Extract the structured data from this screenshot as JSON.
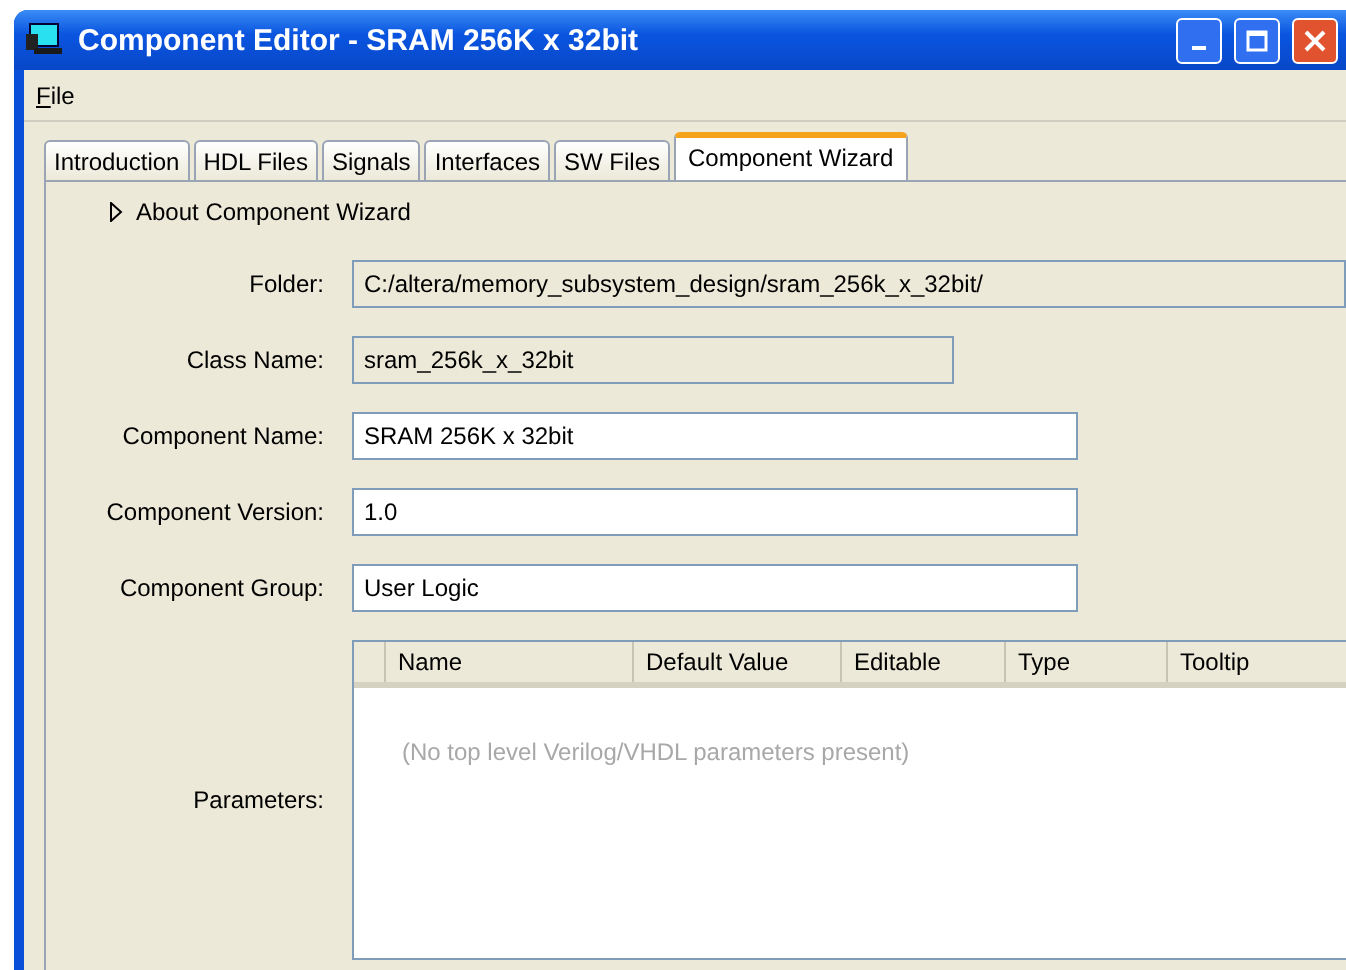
{
  "window": {
    "title": "Component Editor - SRAM 256K x 32bit"
  },
  "menu": [
    {
      "label": "File"
    }
  ],
  "tabs": [
    {
      "label": "Introduction",
      "selected": false
    },
    {
      "label": "HDL Files",
      "selected": false
    },
    {
      "label": "Signals",
      "selected": false
    },
    {
      "label": "Interfaces",
      "selected": false
    },
    {
      "label": "SW Files",
      "selected": false
    },
    {
      "label": "Component Wizard",
      "selected": true
    }
  ],
  "about": {
    "label": "About Component Wizard",
    "expanded": false
  },
  "fields": [
    {
      "label": "Folder:",
      "value": "C:/altera/memory_subsystem_design/sram_256k_x_32bit/",
      "editable": false
    },
    {
      "label": "Class Name:",
      "value": "sram_256k_x_32bit",
      "editable": false
    },
    {
      "label": "Component Name:",
      "value": "SRAM 256K x 32bit",
      "editable": true
    },
    {
      "label": "Component Version:",
      "value": "1.0",
      "editable": true
    },
    {
      "label": "Component Group:",
      "value": "User Logic",
      "editable": true
    }
  ],
  "parameters": {
    "label": "Parameters:",
    "columns": [
      "Name",
      "Default Value",
      "Editable",
      "Type",
      "Tooltip"
    ],
    "empty_message": "(No top level Verilog/VHDL parameters present)"
  }
}
